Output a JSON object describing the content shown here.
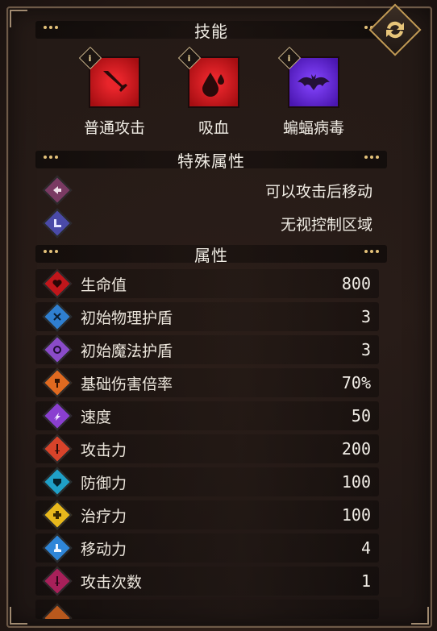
{
  "headers": {
    "skills": "技能",
    "special": "特殊属性",
    "attributes": "属性"
  },
  "skills": [
    {
      "name": "普通攻击",
      "icon": "sword-icon",
      "color": "#c9141a"
    },
    {
      "name": "吸血",
      "icon": "blood-drop-icon",
      "color": "#c9141a"
    },
    {
      "name": "蝙蝠病毒",
      "icon": "bat-icon",
      "color": "#5b1ec9"
    }
  ],
  "special": [
    {
      "text": "可以攻击后移动",
      "icon": "move-after-attack-icon",
      "color": "#7a3a63"
    },
    {
      "text": "无视控制区域",
      "icon": "ignore-zoc-icon",
      "color": "#4a4aa8"
    }
  ],
  "stats": [
    {
      "label": "生命值",
      "value": "800",
      "icon": "heart-icon",
      "color": "#c0161b"
    },
    {
      "label": "初始物理护盾",
      "value": "3",
      "icon": "physical-shield-icon",
      "color": "#2f7fd0"
    },
    {
      "label": "初始魔法护盾",
      "value": "3",
      "icon": "magic-shield-icon",
      "color": "#8a4bc9"
    },
    {
      "label": "基础伤害倍率",
      "value": "70%",
      "icon": "axe-icon",
      "color": "#e06a20"
    },
    {
      "label": "速度",
      "value": "50",
      "icon": "speed-icon",
      "color": "#8a3fd0"
    },
    {
      "label": "攻击力",
      "value": "200",
      "icon": "attack-icon",
      "color": "#d8432a"
    },
    {
      "label": "防御力",
      "value": "100",
      "icon": "defense-icon",
      "color": "#1fa0c8"
    },
    {
      "label": "治疗力",
      "value": "100",
      "icon": "heal-icon",
      "color": "#e8b81c"
    },
    {
      "label": "移动力",
      "value": "4",
      "icon": "boot-icon",
      "color": "#2f86d8"
    },
    {
      "label": "攻击次数",
      "value": "1",
      "icon": "attack-count-icon",
      "color": "#a8205a"
    }
  ]
}
